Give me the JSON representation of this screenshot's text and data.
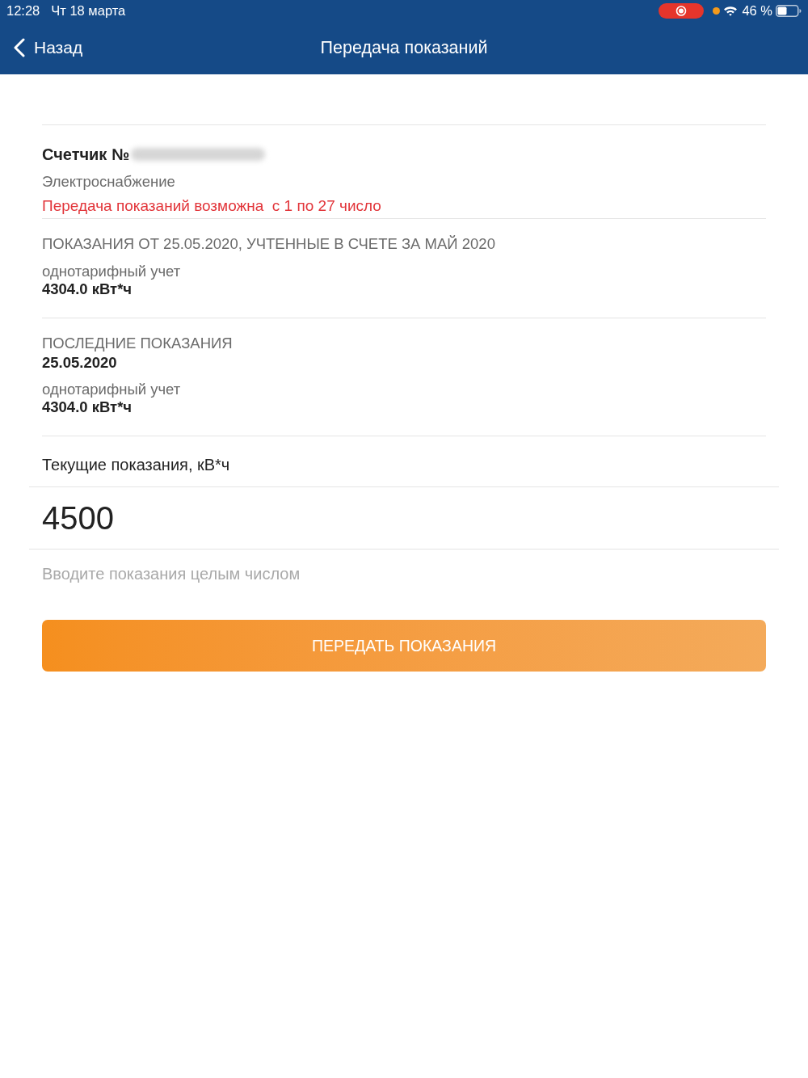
{
  "status_bar": {
    "time": "12:28",
    "date": "Чт 18 марта",
    "recording": true,
    "battery": "46 %"
  },
  "nav_bar": {
    "back_label": "Назад",
    "title": "Передача показаний"
  },
  "meter": {
    "title": "Счетчик №",
    "number_blurred": true,
    "service": "Электроснабжение",
    "notice": "Передача показаний возможна  с 1 по 27 число"
  },
  "readings": [
    {
      "kind": "billed",
      "heading": "ПОКАЗАНИЯ ОТ 25.05.2020, УЧТЕННЫЕ В СЧЕТЕ ЗА МАЙ 2020",
      "tariff": "однотарифный учет",
      "value": "4304.0 кВт*ч"
    },
    {
      "kind": "last",
      "heading": "ПОСЛЕДНИЕ ПОКАЗАНИЯ",
      "date": "25.05.2020",
      "tariff": "однотарифный учет",
      "value": "4304.0 кВт*ч"
    }
  ],
  "current_reading": {
    "label": "Текущие показания, кВ*ч",
    "value": "4500",
    "helper_text": "Вводите показания целым числом"
  },
  "submit_button": {
    "label": "ПЕРЕДАТЬ ПОКАЗАНИЯ"
  }
}
